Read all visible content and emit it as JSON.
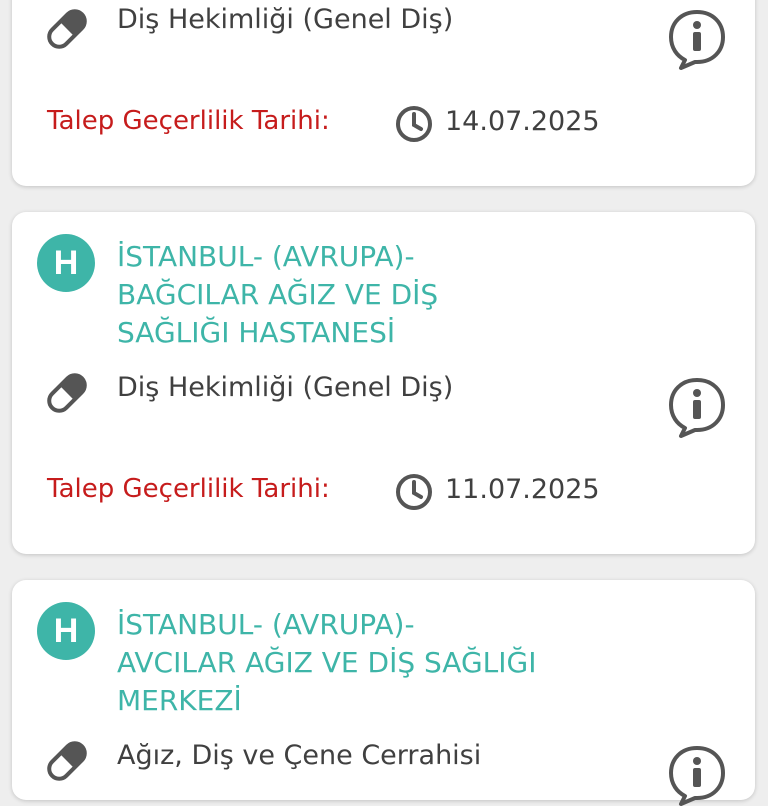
{
  "cards": [
    {
      "department": "Diş Hekimliği (Genel Diş)",
      "validity_label": "Talep Geçerlilik Tarihi:",
      "validity_date": "14.07.2025"
    },
    {
      "badge": "H",
      "hospital_lines": [
        "İSTANBUL- (AVRUPA)-",
        "BAĞCILAR AĞIZ VE DİŞ",
        "SAĞLIĞI HASTANESİ"
      ],
      "department": "Diş Hekimliği (Genel Diş)",
      "validity_label": "Talep Geçerlilik Tarihi:",
      "validity_date": "11.07.2025"
    },
    {
      "badge": "H",
      "hospital_lines": [
        "İSTANBUL- (AVRUPA)-",
        "AVCILAR AĞIZ VE DİŞ SAĞLIĞI",
        "MERKEZİ"
      ],
      "department": "Ağız, Diş ve Çene Cerrahisi"
    }
  ],
  "colors": {
    "accent_teal": "#3eb5a8",
    "label_red": "#c61c1c",
    "text_dark": "#404040",
    "icon_gray": "#555555",
    "background": "#eeeeee"
  },
  "icons": [
    "pill-icon",
    "info-icon",
    "clock-icon",
    "hospital-badge"
  ]
}
